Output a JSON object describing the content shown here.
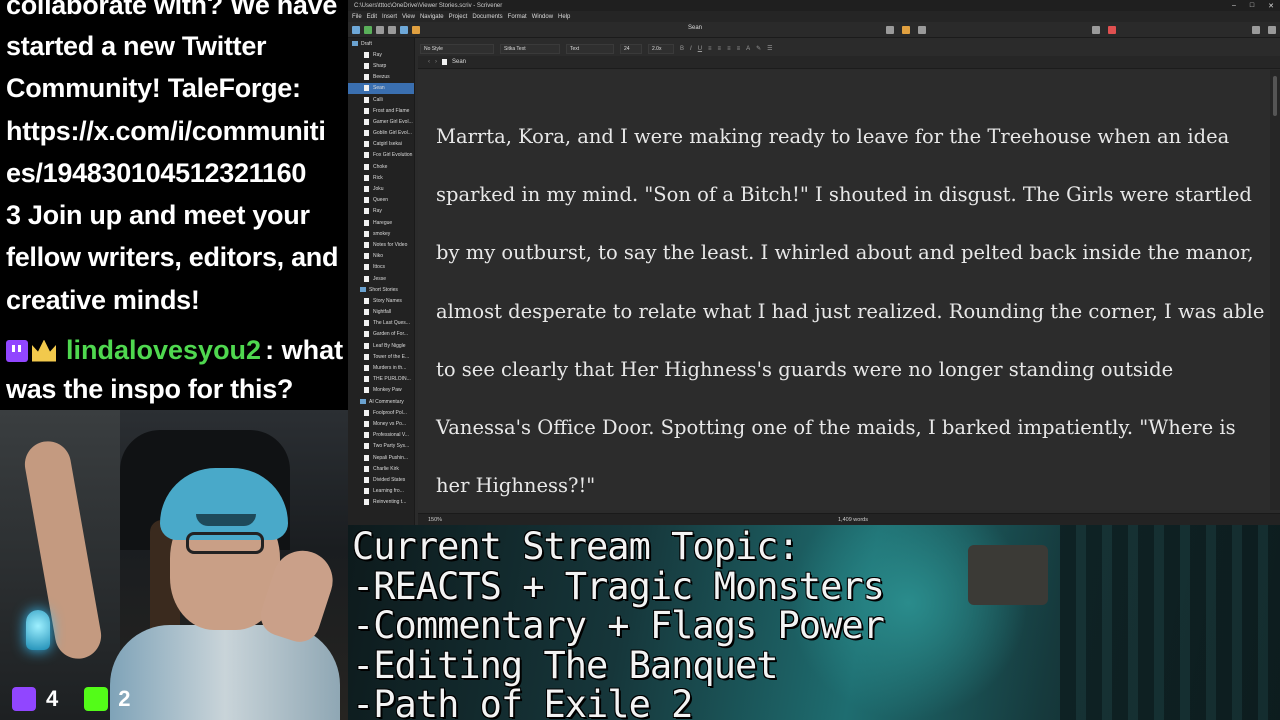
{
  "chat": {
    "lines": [
      "collaborate with? We have",
      "started a new Twitter",
      "Community! TaleForge:",
      "https://x.com/i/communiti",
      "es/194830104512321160",
      "3 Join up and meet your",
      "fellow writers, editors, and",
      "creative minds!"
    ],
    "message": {
      "username": "lindalovesyou2",
      "text_first": " : what",
      "text_second": "was the inspo for this?"
    }
  },
  "viewers": {
    "twitch": "4",
    "kick": "2"
  },
  "app": {
    "title": "C:\\Users\\tttoc\\OneDrive\\Viewer Stories.scriv - Scrivener",
    "menu": [
      "File",
      "Edit",
      "Insert",
      "View",
      "Navigate",
      "Project",
      "Documents",
      "Format",
      "Window",
      "Help"
    ],
    "document_title": "Sean",
    "format": {
      "style": "No Style",
      "font": "Sitka Text",
      "face": "Text",
      "size": "24",
      "spacing": "2.0x"
    },
    "binder": [
      {
        "label": "Draft",
        "type": "folder"
      },
      {
        "label": "Ray",
        "type": "doc"
      },
      {
        "label": "Sharp",
        "type": "doc"
      },
      {
        "label": "Beezus",
        "type": "doc"
      },
      {
        "label": "Sean",
        "type": "doc",
        "selected": true
      },
      {
        "label": "Calli",
        "type": "doc"
      },
      {
        "label": "Frost and Flame",
        "type": "doc"
      },
      {
        "label": "Gamer Girl Evol...",
        "type": "doc"
      },
      {
        "label": "Goblin Girl Evol...",
        "type": "doc"
      },
      {
        "label": "Catgirl Isekai",
        "type": "doc"
      },
      {
        "label": "Fox Girl Evolution",
        "type": "doc"
      },
      {
        "label": "Choke",
        "type": "doc"
      },
      {
        "label": "Rick",
        "type": "doc"
      },
      {
        "label": "Joku",
        "type": "doc"
      },
      {
        "label": "Queen",
        "type": "doc"
      },
      {
        "label": "Ray",
        "type": "doc"
      },
      {
        "label": "Haregue",
        "type": "doc"
      },
      {
        "label": "smokey",
        "type": "doc"
      },
      {
        "label": "Notes for Video",
        "type": "doc"
      },
      {
        "label": "Niko",
        "type": "doc"
      },
      {
        "label": "Ittocs",
        "type": "doc"
      },
      {
        "label": "Jesse",
        "type": "doc"
      },
      {
        "label": "Short Stories",
        "type": "folder"
      },
      {
        "label": "Story Names",
        "type": "doc"
      },
      {
        "label": "Nightfall",
        "type": "doc"
      },
      {
        "label": "The Last Ques...",
        "type": "doc"
      },
      {
        "label": "Garden of For...",
        "type": "doc"
      },
      {
        "label": "Leaf By Niggle",
        "type": "doc"
      },
      {
        "label": "Tower of the E...",
        "type": "doc"
      },
      {
        "label": "Murders in th...",
        "type": "doc"
      },
      {
        "label": "THE PURLOIN...",
        "type": "doc"
      },
      {
        "label": "Monkey Paw",
        "type": "doc"
      },
      {
        "label": "AI Commentary",
        "type": "folder"
      },
      {
        "label": "Foolproof Pol...",
        "type": "doc"
      },
      {
        "label": "Money vs Po...",
        "type": "doc"
      },
      {
        "label": "Professional V...",
        "type": "doc"
      },
      {
        "label": "Two Party Sys...",
        "type": "doc"
      },
      {
        "label": "Nepali Pushin...",
        "type": "doc"
      },
      {
        "label": "Charlie Kirk",
        "type": "doc"
      },
      {
        "label": "Divided States",
        "type": "doc"
      },
      {
        "label": "Learning fro...",
        "type": "doc"
      },
      {
        "label": "Reinventing t...",
        "type": "doc"
      }
    ],
    "editor_text": "Marrta, Kora, and I were making ready to leave for the Treehouse when an idea sparked in my mind. \"Son of a Bitch!\" I shouted in disgust. The Girls were startled by my outburst, to say the least. I whirled about and pelted back inside the manor, almost desperate to relate what I had just realized. Rounding the corner, I was able to see clearly that Her Highness's guards were no longer standing outside Vanessa's Office Door. Spotting one of the maids, I barked impatiently. \"Where is her Highness?!\"",
    "zoom": "150%",
    "word_count": "1,409 words"
  },
  "stream_topic": {
    "lines": [
      "Current Stream Topic:",
      "-REACTS + Tragic Monsters",
      "-Commentary + Flags Power",
      "-Editing The Banquet",
      "-Path of Exile 2"
    ]
  }
}
